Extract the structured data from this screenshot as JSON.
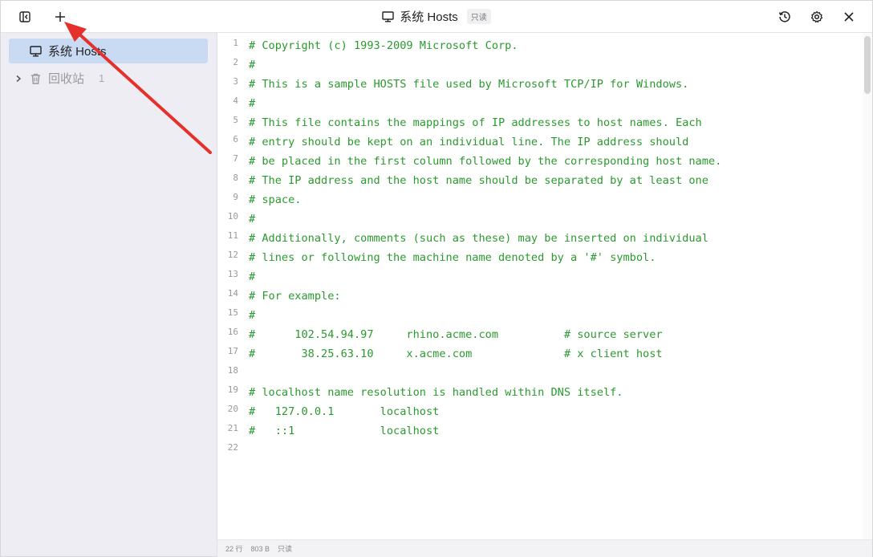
{
  "titlebar": {
    "title": "系统 Hosts",
    "readonly_badge": "只读",
    "icons": [
      "sidebar-toggle-icon",
      "plus-icon",
      "history-icon",
      "gear-icon",
      "close-icon"
    ]
  },
  "sidebar": {
    "items": [
      {
        "label": "系统 Hosts",
        "icon": "monitor-icon",
        "active": true
      },
      {
        "label": "回收站",
        "icon": "trash-icon",
        "count": "1"
      }
    ]
  },
  "editor": {
    "lines": [
      {
        "n": "1",
        "text": "# Copyright (c) 1993-2009 Microsoft Corp."
      },
      {
        "n": "2",
        "text": "#"
      },
      {
        "n": "3",
        "text": "# This is a sample HOSTS file used by Microsoft TCP/IP for Windows."
      },
      {
        "n": "4",
        "text": "#"
      },
      {
        "n": "5",
        "text": "# This file contains the mappings of IP addresses to host names. Each"
      },
      {
        "n": "6",
        "text": "# entry should be kept on an individual line. The IP address should"
      },
      {
        "n": "7",
        "text": "# be placed in the first column followed by the corresponding host name."
      },
      {
        "n": "8",
        "text": "# The IP address and the host name should be separated by at least one"
      },
      {
        "n": "9",
        "text": "# space."
      },
      {
        "n": "10",
        "text": "#"
      },
      {
        "n": "11",
        "text": "# Additionally, comments (such as these) may be inserted on individual"
      },
      {
        "n": "12",
        "text": "# lines or following the machine name denoted by a '#' symbol."
      },
      {
        "n": "13",
        "text": "#"
      },
      {
        "n": "14",
        "text": "# For example:"
      },
      {
        "n": "15",
        "text": "#"
      },
      {
        "n": "16",
        "text": "#      102.54.94.97     rhino.acme.com          # source server"
      },
      {
        "n": "17",
        "text": "#       38.25.63.10     x.acme.com              # x client host"
      },
      {
        "n": "18",
        "text": ""
      },
      {
        "n": "19",
        "text": "# localhost name resolution is handled within DNS itself."
      },
      {
        "n": "20",
        "text": "#   127.0.0.1       localhost"
      },
      {
        "n": "21",
        "text": "#   ::1             localhost"
      },
      {
        "n": "22",
        "text": ""
      }
    ]
  },
  "statusbar": {
    "lines": "22 行",
    "size": "803 B",
    "mode": "只读"
  },
  "colors": {
    "comment_green": "#2a9a2e",
    "sidebar_bg": "#efedf4",
    "active_item_bg": "#c9daf3",
    "annotation_red": "#e5312c"
  }
}
